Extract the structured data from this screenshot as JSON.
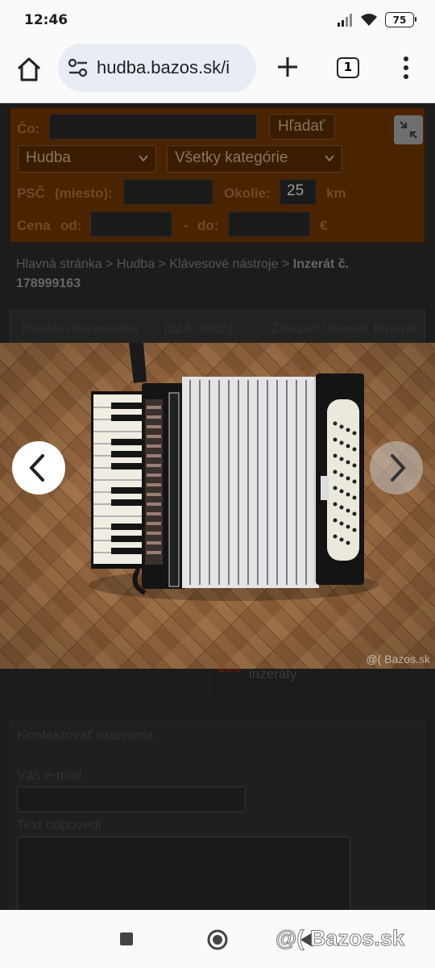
{
  "status_bar": {
    "time": "12:46",
    "battery": "75"
  },
  "browser": {
    "url": "hudba.bazos.sk/i",
    "tab_count": "1"
  },
  "search": {
    "what_label": "Čo:",
    "search_button": "Hľadať",
    "section_select": "Hudba",
    "category_select": "Všetky kategórie",
    "zip_label": "PSČ",
    "place_label": "(miesto):",
    "radius_label": "Okolie:",
    "radius_value": "25",
    "radius_unit": "km",
    "price_label": "Cena",
    "from_label": "od:",
    "dash": "-",
    "to_label": "do:",
    "currency": "€"
  },
  "breadcrumb": {
    "text": "Hlavná stránka > Hudba > Klávesové nástroje >",
    "current": "Inzerát č. 178999163"
  },
  "listing": {
    "title": "Predám harmoniku",
    "date": "- [22.5. 2025]",
    "actions": "Zmazať/ Upraviť/ Topovať"
  },
  "other_ads": {
    "label": "inzeráty"
  },
  "contact": {
    "heading": "Kontaktovať inzerenta",
    "email_label": "Váš e-mail",
    "reply_label": "Text odpovedi"
  },
  "photo": {
    "watermark": "@( Bazos.sk",
    "subject": "accordion"
  },
  "footer_watermark": "@( Bazos.sk",
  "colors": {
    "accent_brown": "#4a2300",
    "dim_overlay": "#1c1c1c"
  }
}
